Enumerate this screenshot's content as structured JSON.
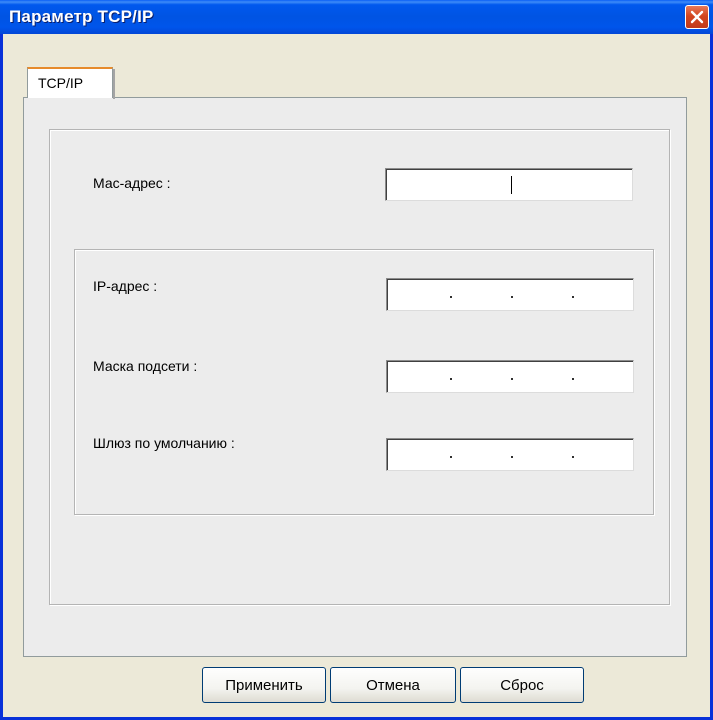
{
  "window": {
    "title": "Параметр TCP/IP"
  },
  "tabs": [
    {
      "label": "TCP/IP",
      "selected": true
    }
  ],
  "fields": {
    "mac": {
      "label": "Мас-адрес :",
      "value": ""
    },
    "ip": {
      "label": "IP-адрес :",
      "value": " .  .  . "
    },
    "subnet": {
      "label": "Маска подсети :",
      "value": " .  .  . "
    },
    "gateway": {
      "label": "Шлюз по умолчанию :",
      "value": " .  .  . "
    }
  },
  "buttons": {
    "apply": "Применить",
    "cancel": "Отмена",
    "reset": "Сброс"
  },
  "icons": {
    "close": "close-icon"
  },
  "colors": {
    "titlebar": "#0054e3",
    "close_button": "#d3461f",
    "dialog_background": "#ece9d8",
    "tab_highlight": "#e68b2c"
  }
}
